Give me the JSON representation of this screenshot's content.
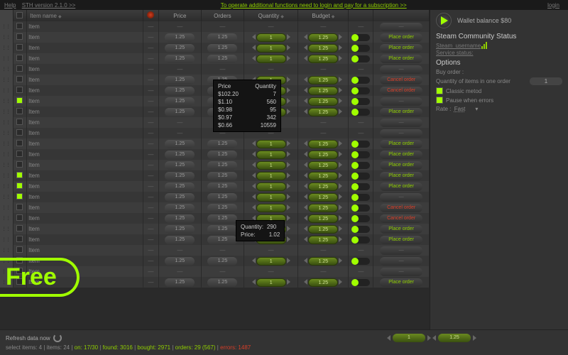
{
  "topbar": {
    "help_label": "Help",
    "version_label": "STH version 2.1.0 >>",
    "center_link": "To operate additional functions need to login and pay for a subscription >>",
    "login_label": "login"
  },
  "columns": {
    "name": "Item name",
    "price": "Price",
    "orders": "Orders",
    "quantity": "Quantity",
    "budget": "Budget"
  },
  "tooltip1": {
    "header_price": "Price",
    "header_qty": "Quantity",
    "lines": [
      {
        "p": "$102.20",
        "q": "7"
      },
      {
        "p": "$1.10",
        "q": "560"
      },
      {
        "p": "$0.98",
        "q": "95"
      },
      {
        "p": "$0.97",
        "q": "342"
      },
      {
        "p": "$0.66",
        "q": "10559"
      }
    ]
  },
  "tooltip2": {
    "quantity_label": "Quantity:",
    "quantity_value": "290",
    "price_label": "Price:",
    "price_value": "1.02"
  },
  "rows": [
    {
      "sel": false,
      "name": "Item",
      "state": "none",
      "action": "neutral",
      "label": "—",
      "empty": true
    },
    {
      "sel": false,
      "name": "Item",
      "state": "on",
      "action": "place",
      "label": "Place order"
    },
    {
      "sel": false,
      "name": "Item",
      "state": "on",
      "action": "place",
      "label": "Place order"
    },
    {
      "sel": false,
      "name": "Item",
      "state": "on",
      "action": "place",
      "label": "Place order"
    },
    {
      "sel": false,
      "name": "Item",
      "state": "none",
      "action": "neutral",
      "label": "—",
      "empty": true
    },
    {
      "sel": false,
      "name": "Item",
      "state": "on",
      "action": "cancel",
      "label": "Cancel order"
    },
    {
      "sel": false,
      "name": "Item",
      "state": "on",
      "action": "cancel",
      "label": "Cancel order"
    },
    {
      "sel": true,
      "name": "Item",
      "state": "on",
      "action": "neutral",
      "label": "—"
    },
    {
      "sel": false,
      "name": "Item",
      "state": "on",
      "action": "place",
      "label": "Place order"
    },
    {
      "sel": false,
      "name": "Item",
      "state": "none",
      "action": "neutral",
      "label": "—",
      "empty": true
    },
    {
      "sel": false,
      "name": "Item",
      "state": "none",
      "action": "neutral",
      "label": "—",
      "empty": true
    },
    {
      "sel": false,
      "name": "Item",
      "state": "on",
      "action": "place",
      "label": "Place order"
    },
    {
      "sel": false,
      "name": "Item",
      "state": "on",
      "action": "place",
      "label": "Place order"
    },
    {
      "sel": false,
      "name": "Item",
      "state": "on",
      "action": "place",
      "label": "Place order"
    },
    {
      "sel": true,
      "name": "Item",
      "state": "on",
      "action": "place",
      "label": "Place order"
    },
    {
      "sel": true,
      "name": "Item",
      "state": "on",
      "action": "place",
      "label": "Place order"
    },
    {
      "sel": true,
      "name": "Item",
      "state": "on",
      "action": "neutral",
      "label": "—"
    },
    {
      "sel": false,
      "name": "Item",
      "state": "on",
      "action": "cancel",
      "label": "Cancel order"
    },
    {
      "sel": false,
      "name": "Item",
      "state": "on",
      "action": "cancel",
      "label": "Cancel order"
    },
    {
      "sel": false,
      "name": "Item",
      "state": "on",
      "action": "place",
      "label": "Place order"
    },
    {
      "sel": false,
      "name": "Item",
      "state": "on",
      "action": "place",
      "label": "Place order"
    },
    {
      "sel": false,
      "name": "Item",
      "state": "none",
      "action": "neutral",
      "label": "—",
      "empty": true
    },
    {
      "sel": false,
      "name": "Item",
      "state": "on",
      "action": "neutral",
      "label": "—"
    },
    {
      "sel": false,
      "name": "Item",
      "state": "none",
      "action": "neutral",
      "label": "—",
      "empty": true
    },
    {
      "sel": false,
      "name": "Item",
      "state": "on",
      "action": "place",
      "label": "Place order"
    }
  ],
  "cell_defaults": {
    "price": "1.25",
    "orders": "1.25",
    "quantity": "1",
    "budget": "1.25"
  },
  "sidebar": {
    "wallet": "Wallet balance $80",
    "status_title": "Steam Community Status",
    "username": "Steam_username",
    "service": "Service status:",
    "options_title": "Options",
    "buy_order": "Buy order :",
    "qty_in_order": "Quantity of items in one order",
    "qty_value": "1",
    "classic": "Classic metod",
    "pause": "Pause when errors",
    "rate_label": "Rate :",
    "rate_value": "Fast"
  },
  "free_label": "Free",
  "footer": {
    "refresh": "Refresh data now",
    "pill1": "1",
    "pill2": "1.25",
    "status": {
      "select_items": "select items: 4",
      "items": "items: 24",
      "on": "on: 17/30",
      "found": "found: 3016",
      "bought": "bought: 2971",
      "orders": "orders: 29 (567)",
      "errors": "errors: 1487"
    }
  }
}
